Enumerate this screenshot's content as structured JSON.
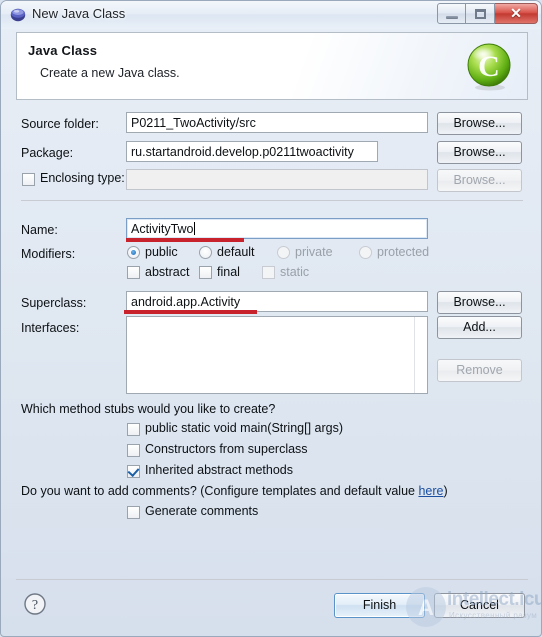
{
  "window": {
    "title": "New Java Class",
    "icon": "eclipse-sphere-icon",
    "buttons": {
      "minimize": "minimize",
      "maximize": "maximize",
      "close": "✕"
    }
  },
  "header": {
    "title": "Java Class",
    "subtitle": "Create a new Java class.",
    "icon": "green-class-c-icon"
  },
  "form": {
    "source_folder": {
      "label": "Source folder:",
      "value": "P0211_TwoActivity/src",
      "browse": "Browse..."
    },
    "package": {
      "label": "Package:",
      "value": "ru.startandroid.develop.p0211twoactivity",
      "browse": "Browse..."
    },
    "enclosing_type": {
      "label": "Enclosing type:",
      "checked": false,
      "value": "",
      "browse": "Browse...",
      "disabled": true
    },
    "name": {
      "label": "Name:",
      "value": "ActivityTwo",
      "focused": true,
      "annotated": true
    },
    "modifiers": {
      "label": "Modifiers:",
      "radios": [
        {
          "label": "public",
          "selected": true,
          "disabled": false
        },
        {
          "label": "default",
          "selected": false,
          "disabled": false
        },
        {
          "label": "private",
          "selected": false,
          "disabled": true
        },
        {
          "label": "protected",
          "selected": false,
          "disabled": true
        }
      ],
      "checkboxes": [
        {
          "label": "abstract",
          "checked": false,
          "disabled": false
        },
        {
          "label": "final",
          "checked": false,
          "disabled": false
        },
        {
          "label": "static",
          "checked": false,
          "disabled": true
        }
      ]
    },
    "superclass": {
      "label": "Superclass:",
      "value": "android.app.Activity",
      "browse": "Browse...",
      "annotated": true
    },
    "interfaces": {
      "label": "Interfaces:",
      "items": [],
      "add": "Add...",
      "remove": "Remove",
      "remove_disabled": true
    }
  },
  "stubs": {
    "question": "Which method stubs would you like to create?",
    "options": [
      {
        "label": "public static void main(String[] args)",
        "checked": false
      },
      {
        "label": "Constructors from superclass",
        "checked": false
      },
      {
        "label": "Inherited abstract methods",
        "checked": true
      }
    ]
  },
  "comments": {
    "question_pre": "Do you want to add comments? (Configure templates and default value ",
    "link": "here",
    "question_post": ")",
    "option": {
      "label": "Generate comments",
      "checked": false
    }
  },
  "footer": {
    "help": "?",
    "finish": "Finish",
    "cancel": "Cancel"
  },
  "watermark": {
    "text": "intellect.icu",
    "subtitle": "Искусственный разум",
    "logo": "A"
  },
  "colors": {
    "annotation_red": "#c8232c",
    "accent_blue": "#1667b2",
    "link_blue": "#1c4fa0"
  }
}
